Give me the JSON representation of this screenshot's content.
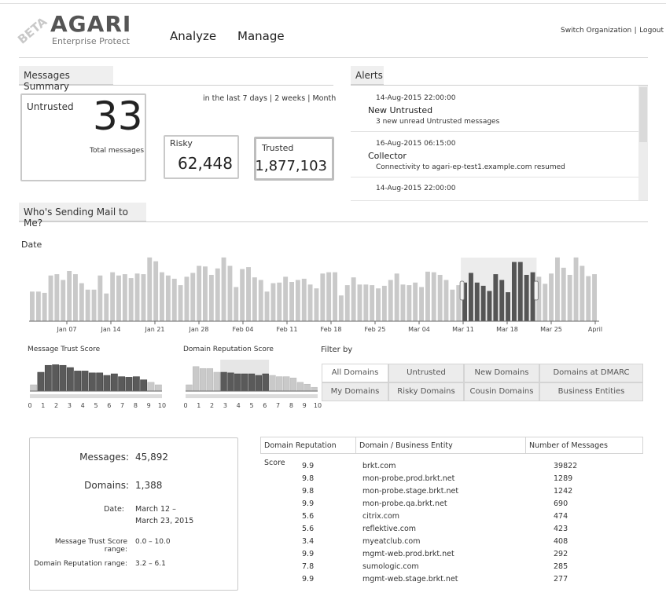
{
  "header": {
    "beta": "BETA",
    "logo": "AGARI",
    "product": "Enterprise Protect",
    "nav": [
      "Analyze",
      "Manage"
    ],
    "switch_org": "Switch Organization",
    "separator": "|",
    "logout": "Logout"
  },
  "messages_summary": {
    "title": "Messages Summary",
    "untrusted_label": "Untrusted",
    "untrusted_count": "33",
    "total_label": "Total messages",
    "range_last": "in the last 7 days",
    "range_sep": "|",
    "range_2w": "2 weeks",
    "range_month": "Month",
    "risky_label": "Risky",
    "risky_count": "62,448",
    "trusted_label": "Trusted",
    "trusted_count": "1,877,103"
  },
  "alerts": {
    "title": "Alerts",
    "items": [
      {
        "date": "14-Aug-2015  22:00:00",
        "title": "New Untrusted",
        "desc": "3 new unread Untrusted messages"
      },
      {
        "date": "16-Aug-2015 06:15:00",
        "title": "Collector",
        "desc": "Connectivity to agari-ep-test1.example.com resumed"
      },
      {
        "date": "14-Aug-2015  22:00:00",
        "title": "",
        "desc": ""
      }
    ]
  },
  "who_sending": {
    "title": "Who's Sending Mail to Me?"
  },
  "date_chart": {
    "label": "Date",
    "tick_labels": [
      "Jan 07",
      "Jan 14",
      "Jan 21",
      "Jan 28",
      "Feb 04",
      "Feb 11",
      "Feb 18",
      "Feb 25",
      "Mar 04",
      "Mar 11",
      "Mar 18",
      "Mar 25",
      "April"
    ]
  },
  "filters": {
    "trust_title": "Message Trust Score",
    "domain_title": "Domain Reputation Score",
    "filter_by": "Filter by",
    "buttons_row1": [
      "All Domains",
      "Untrusted Domains",
      "New Domains",
      "Domains at DMARC Reject"
    ],
    "buttons_row2": [
      "My Domains",
      "Risky Domains",
      "Cousin Domains",
      "Business Entities"
    ],
    "score_ticks": [
      "0",
      "1",
      "2",
      "3",
      "4",
      "5",
      "6",
      "7",
      "8",
      "9",
      "10"
    ]
  },
  "selection_stats": {
    "messages_label": "Messages:",
    "messages_value": "45,892",
    "domains_label": "Domains:",
    "domains_value": "1,388",
    "date_label": "Date:",
    "date_value_line1": "March 12 –",
    "date_value_line2": "March 23, 2015",
    "trust_range_label": "Message Trust Score range:",
    "trust_range_value": "0.0 – 10.0",
    "domain_range_label": "Domain Reputation range:",
    "domain_range_value": "3.2 – 6.1"
  },
  "domain_table": {
    "headers": [
      "Domain Reputation Score",
      "Domain / Business Entity",
      "Number of Messages"
    ],
    "rows": [
      {
        "score": "9.9",
        "domain": "brkt.com",
        "messages": "39822"
      },
      {
        "score": "9.8",
        "domain": "mon-probe.prod.brkt.net",
        "messages": "1289"
      },
      {
        "score": "9.8",
        "domain": "mon-probe.stage.brkt.net",
        "messages": "1242"
      },
      {
        "score": "9.9",
        "domain": "mon-probe.qa.brkt.net",
        "messages": "690"
      },
      {
        "score": "5.6",
        "domain": "citrix.com",
        "messages": "474"
      },
      {
        "score": "5.6",
        "domain": "reflektive.com",
        "messages": "423"
      },
      {
        "score": "3.4",
        "domain": "myeatclub.com",
        "messages": "408"
      },
      {
        "score": "9.9",
        "domain": "mgmt-web.prod.brkt.net",
        "messages": "292"
      },
      {
        "score": "7.8",
        "domain": "sumologic.com",
        "messages": "285"
      },
      {
        "score": "9.9",
        "domain": "mgmt-web.stage.brkt.net",
        "messages": "277"
      }
    ]
  },
  "chart_data": [
    {
      "type": "bar",
      "title": "",
      "xlabel": "Date",
      "ylabel": "",
      "tick_labels": [
        "Jan 07",
        "Jan 14",
        "Jan 21",
        "Jan 28",
        "Feb 04",
        "Feb 11",
        "Feb 18",
        "Feb 25",
        "Mar 04",
        "Mar 11",
        "Mar 18",
        "Mar 25",
        "April"
      ],
      "values": [
        0.46,
        0.46,
        0.44,
        0.71,
        0.73,
        0.64,
        0.78,
        0.73,
        0.59,
        0.49,
        0.49,
        0.71,
        0.43,
        0.76,
        0.71,
        0.73,
        0.67,
        0.74,
        0.73,
        0.99,
        0.93,
        0.76,
        0.71,
        0.66,
        0.56,
        0.69,
        0.75,
        0.86,
        0.85,
        0.72,
        0.82,
        0.99,
        0.86,
        0.53,
        0.81,
        0.84,
        0.68,
        0.64,
        0.46,
        0.59,
        0.6,
        0.69,
        0.61,
        0.64,
        0.66,
        0.57,
        0.51,
        0.74,
        0.76,
        0.76,
        0.4,
        0.56,
        0.68,
        0.57,
        0.57,
        0.56,
        0.51,
        0.55,
        0.64,
        0.74,
        0.57,
        0.56,
        0.6,
        0.53,
        0.77,
        0.76,
        0.72,
        0.64,
        0.49,
        0.56,
        0.6,
        0.75,
        0.6,
        0.55,
        0.47,
        0.73,
        0.64,
        0.45,
        0.92,
        0.92,
        0.72,
        0.76,
        0.69,
        0.58,
        0.74,
        0.99,
        0.83,
        0.72,
        0.99,
        0.86,
        0.7,
        0.73
      ],
      "selected_range": [
        70,
        81
      ]
    },
    {
      "type": "bar",
      "title": "Message Trust Score",
      "x_ticks": [
        "0",
        "1",
        "2",
        "3",
        "4",
        "5",
        "6",
        "7",
        "8",
        "9",
        "10"
      ],
      "values": [
        0.2,
        0.6,
        0.82,
        0.84,
        0.82,
        0.75,
        0.64,
        0.64,
        0.58,
        0.58,
        0.5,
        0.55,
        0.46,
        0.44,
        0.46,
        0.36,
        0.28,
        0.2
      ]
    },
    {
      "type": "bar",
      "title": "Domain Reputation Score",
      "x_ticks": [
        "0",
        "1",
        "2",
        "3",
        "4",
        "5",
        "6",
        "7",
        "8",
        "9",
        "10"
      ],
      "values": [
        0.2,
        0.78,
        0.72,
        0.72,
        0.6,
        0.6,
        0.58,
        0.55,
        0.55,
        0.55,
        0.5,
        0.55,
        0.5,
        0.46,
        0.46,
        0.42,
        0.28,
        0.22,
        0.12
      ],
      "selected_range": [
        5,
        11
      ]
    }
  ]
}
